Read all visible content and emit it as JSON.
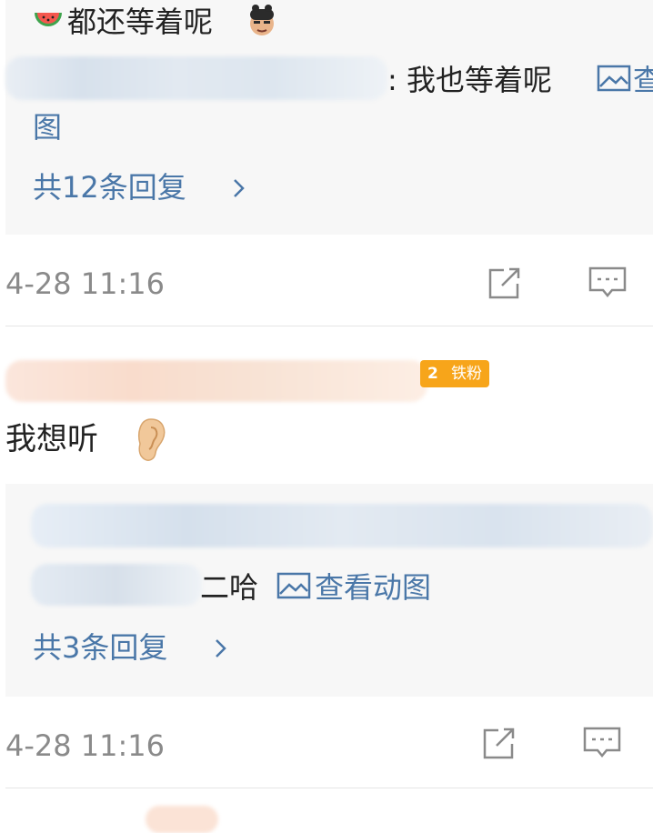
{
  "thread1": {
    "top_reply_text": "都还等着呢",
    "sub_reply_text": ": 我也等着呢",
    "view_image_link": "查看图",
    "view_image_wrap": "图",
    "reply_count_link": "共12条回复",
    "timestamp": "4-28 11:16"
  },
  "comment2": {
    "badge_level": "2",
    "badge_label": "铁粉",
    "text": "我想听",
    "sub_reply_text": "二哈",
    "view_gif_link": "查看动图",
    "reply_count_link": "共3条回复",
    "timestamp": "4-28 11:16"
  },
  "icons": {
    "watermelon": "watermelon-emoji-icon",
    "ear": "ear-emoji-icon",
    "share": "share-icon",
    "comment": "comment-icon",
    "image": "image-icon",
    "chevron": "chevron-right-icon"
  }
}
